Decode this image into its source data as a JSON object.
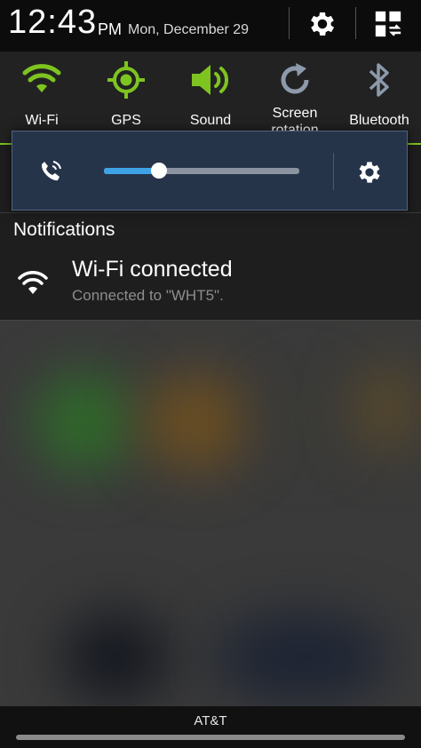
{
  "status": {
    "time": "12:43",
    "ampm": "PM",
    "date": "Mon, December 29"
  },
  "toggles": [
    {
      "label": "Wi-Fi",
      "icon": "wifi-icon",
      "state": "on"
    },
    {
      "label": "GPS",
      "icon": "gps-icon",
      "state": "on"
    },
    {
      "label": "Sound",
      "icon": "sound-icon",
      "state": "on"
    },
    {
      "label": "Screen rotation",
      "icon": "screen-rotation-icon",
      "state": "off"
    },
    {
      "label": "Bluetooth",
      "icon": "bluetooth-icon",
      "state": "off"
    }
  ],
  "volume_popup": {
    "icon": "ringer-icon",
    "level": 0.28
  },
  "notifications": {
    "title": "Notifications",
    "items": [
      {
        "icon": "wifi-icon",
        "title": "Wi-Fi connected",
        "text": "Connected to \"WHT5\"."
      }
    ]
  },
  "carrier": "AT&T",
  "colors": {
    "active": "#7ec421",
    "inactive": "#8c9aab",
    "accent": "#3ea3e6",
    "popup_bg": "#26344a"
  }
}
